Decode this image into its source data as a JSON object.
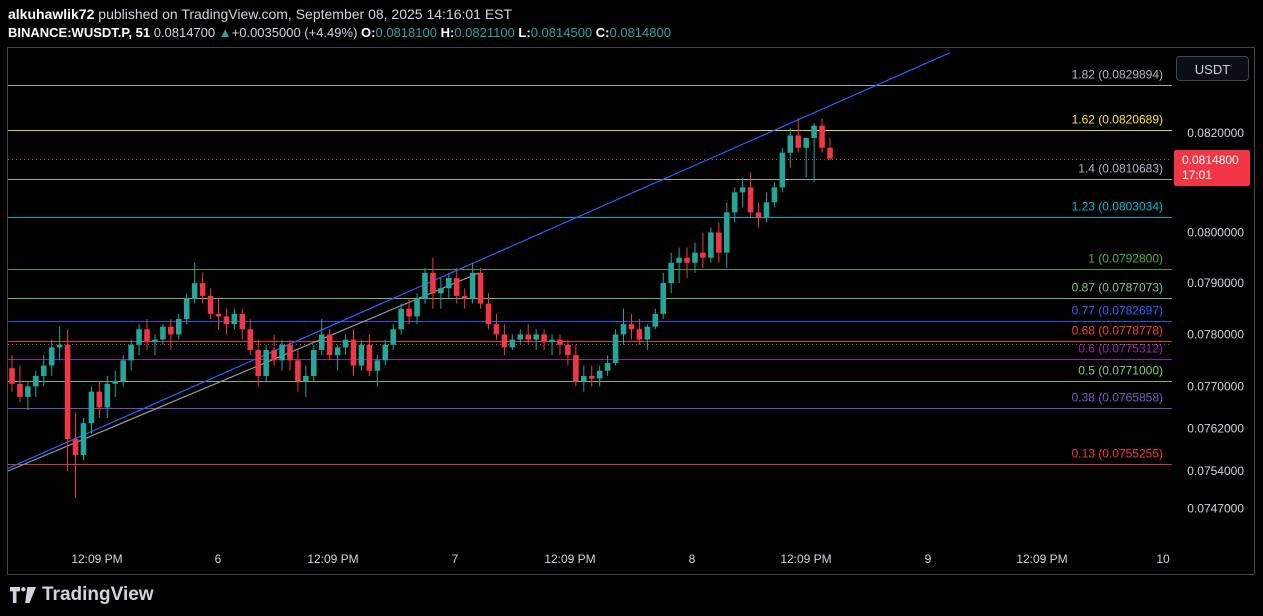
{
  "header": {
    "publisher": "alkuhawlik72",
    "published_text": "published on TradingView.com, September 08, 2025 14:16:01 EST",
    "symbol": "BINANCE:WUSDT.P, 51",
    "last": "0.0814700",
    "change_arrow": "▲",
    "change": "+0.0035000 (+4.49%)",
    "o_label": "O:",
    "o": "0.0818100",
    "h_label": "H:",
    "h": "0.0821100",
    "l_label": "L:",
    "l": "0.0814500",
    "c_label": "C:",
    "c": "0.0814800"
  },
  "currency_button": "USDT",
  "price_tag": {
    "price": "0.0814800",
    "countdown": "17:01"
  },
  "footer": {
    "brand": "TradingView"
  },
  "colors": {
    "up": "#26a69a",
    "down": "#f23645",
    "trendline": "#2962ff",
    "trendline2": "#9598a1"
  },
  "chart_data": {
    "type": "candlestick",
    "y_scale": "log",
    "y_axis_labels": [
      "0.0820000",
      "0.0800000",
      "0.0790000",
      "0.0780000",
      "0.0770000",
      "0.0762000",
      "0.0754000",
      "0.0747000"
    ],
    "y_axis_values": [
      0.082,
      0.08,
      0.079,
      0.078,
      0.077,
      0.0762,
      0.0754,
      0.0747
    ],
    "x_axis_labels": [
      "12:09 PM",
      "6",
      "12:09 PM",
      "7",
      "12:09 PM",
      "8",
      "12:09 PM",
      "9",
      "12:09 PM",
      "10"
    ],
    "fib_levels": [
      {
        "ratio": "1.82",
        "price": 0.0829894,
        "label": "1.82 (0.0829894)",
        "color": "#b2b5be"
      },
      {
        "ratio": "1.62",
        "price": 0.0820689,
        "label": "1.62 (0.0820689)",
        "color": "#f7e733"
      },
      {
        "ratio": "1.4",
        "price": 0.0810683,
        "label": "1.4 (0.0810683)",
        "color": "#b2b5be"
      },
      {
        "ratio": "1.23",
        "price": 0.0803034,
        "label": "1.23 (0.0803034)",
        "color": "#00bcd4"
      },
      {
        "ratio": "1",
        "price": 0.07928,
        "label": "1 (0.0792800)",
        "color": "#4caf50"
      },
      {
        "ratio": "0.87",
        "price": 0.0787073,
        "label": "0.87 (0.0787073)",
        "color": "#81c784"
      },
      {
        "ratio": "0.77",
        "price": 0.0782697,
        "label": "0.77 (0.0782697)",
        "color": "#2962ff"
      },
      {
        "ratio": "0.68",
        "price": 0.0778778,
        "label": "0.68 (0.0778778)",
        "color": "#f44336"
      },
      {
        "ratio": "0.6",
        "price": 0.0775312,
        "label": "0.6 (0.0775312)",
        "color": "#9c27b0"
      },
      {
        "ratio": "0.5",
        "price": 0.0771,
        "label": "0.5 (0.0771000)",
        "color": "#81c784"
      },
      {
        "ratio": "0.38",
        "price": 0.0765858,
        "label": "0.38 (0.0765858)",
        "color": "#7e57c2"
      },
      {
        "ratio": "0.13",
        "price": 0.0755255,
        "label": "0.13 (0.0755255)",
        "color": "#f23645"
      }
    ],
    "trendlines": [
      {
        "from": [
          0,
          0.07545
        ],
        "to": [
          1.0,
          0.08365
        ],
        "color": "#2962ff"
      },
      {
        "from": [
          0,
          0.0754
        ],
        "to": [
          0.5,
          0.0792
        ],
        "color": "#9598a1"
      }
    ],
    "current_price": 0.08148,
    "candles": [
      [
        0.07735,
        0.0776,
        0.0769,
        0.07705
      ],
      [
        0.07705,
        0.0774,
        0.0767,
        0.0768
      ],
      [
        0.0768,
        0.0771,
        0.07655,
        0.077
      ],
      [
        0.077,
        0.0773,
        0.0768,
        0.0772
      ],
      [
        0.0772,
        0.0776,
        0.077,
        0.0774
      ],
      [
        0.0774,
        0.0779,
        0.0772,
        0.07775
      ],
      [
        0.07775,
        0.07815,
        0.0775,
        0.0778
      ],
      [
        0.0778,
        0.0781,
        0.0754,
        0.076
      ],
      [
        0.076,
        0.0765,
        0.0749,
        0.0757
      ],
      [
        0.0757,
        0.0764,
        0.0756,
        0.0763
      ],
      [
        0.0763,
        0.077,
        0.0761,
        0.0769
      ],
      [
        0.0769,
        0.0771,
        0.0764,
        0.0766
      ],
      [
        0.0766,
        0.0772,
        0.0764,
        0.07705
      ],
      [
        0.07705,
        0.0773,
        0.0768,
        0.0771
      ],
      [
        0.0771,
        0.0776,
        0.077,
        0.0775
      ],
      [
        0.0775,
        0.0779,
        0.0773,
        0.0778
      ],
      [
        0.0778,
        0.0782,
        0.0776,
        0.0781
      ],
      [
        0.0781,
        0.0783,
        0.0777,
        0.07785
      ],
      [
        0.07785,
        0.078,
        0.0776,
        0.0779
      ],
      [
        0.0779,
        0.0782,
        0.0778,
        0.07815
      ],
      [
        0.07815,
        0.0783,
        0.0777,
        0.078
      ],
      [
        0.078,
        0.0784,
        0.0779,
        0.0783
      ],
      [
        0.0783,
        0.0788,
        0.0782,
        0.0787
      ],
      [
        0.0787,
        0.0794,
        0.0786,
        0.079
      ],
      [
        0.079,
        0.0792,
        0.0786,
        0.07875
      ],
      [
        0.07875,
        0.0789,
        0.0783,
        0.0784
      ],
      [
        0.0784,
        0.0787,
        0.0781,
        0.07835
      ],
      [
        0.07835,
        0.0785,
        0.078,
        0.0782
      ],
      [
        0.0782,
        0.0785,
        0.0781,
        0.0784
      ],
      [
        0.0784,
        0.0785,
        0.0779,
        0.0781
      ],
      [
        0.0781,
        0.0783,
        0.0776,
        0.0777
      ],
      [
        0.0777,
        0.0779,
        0.077,
        0.0772
      ],
      [
        0.0772,
        0.0778,
        0.0771,
        0.0777
      ],
      [
        0.0777,
        0.078,
        0.0774,
        0.0775
      ],
      [
        0.0775,
        0.0779,
        0.0773,
        0.0778
      ],
      [
        0.0778,
        0.0779,
        0.0773,
        0.0775
      ],
      [
        0.0775,
        0.0777,
        0.0769,
        0.0771
      ],
      [
        0.0771,
        0.0774,
        0.0768,
        0.0772
      ],
      [
        0.0772,
        0.0778,
        0.0771,
        0.0777
      ],
      [
        0.0777,
        0.0783,
        0.0776,
        0.078
      ],
      [
        0.078,
        0.0781,
        0.0775,
        0.0776
      ],
      [
        0.0776,
        0.0778,
        0.0773,
        0.07775
      ],
      [
        0.07775,
        0.078,
        0.0776,
        0.0779
      ],
      [
        0.0779,
        0.0781,
        0.0772,
        0.0774
      ],
      [
        0.0774,
        0.0779,
        0.0773,
        0.0778
      ],
      [
        0.0778,
        0.078,
        0.0772,
        0.0773
      ],
      [
        0.0773,
        0.0776,
        0.077,
        0.0775
      ],
      [
        0.0775,
        0.0779,
        0.0774,
        0.0778
      ],
      [
        0.0778,
        0.0782,
        0.0777,
        0.0781
      ],
      [
        0.0781,
        0.0786,
        0.078,
        0.0785
      ],
      [
        0.0785,
        0.0787,
        0.0782,
        0.07835
      ],
      [
        0.07835,
        0.0788,
        0.0782,
        0.0787
      ],
      [
        0.0787,
        0.0793,
        0.0786,
        0.0792
      ],
      [
        0.0792,
        0.0795,
        0.0785,
        0.0788
      ],
      [
        0.0788,
        0.0791,
        0.0785,
        0.0789
      ],
      [
        0.0789,
        0.0792,
        0.0787,
        0.0791
      ],
      [
        0.0791,
        0.0793,
        0.0786,
        0.07875
      ],
      [
        0.07875,
        0.0789,
        0.0785,
        0.0787
      ],
      [
        0.0787,
        0.0794,
        0.0786,
        0.0792
      ],
      [
        0.0792,
        0.0793,
        0.0785,
        0.0786
      ],
      [
        0.0786,
        0.0788,
        0.0781,
        0.0782
      ],
      [
        0.0782,
        0.0784,
        0.0779,
        0.078
      ],
      [
        0.078,
        0.0782,
        0.0776,
        0.07775
      ],
      [
        0.07775,
        0.078,
        0.0777,
        0.0779
      ],
      [
        0.0779,
        0.0781,
        0.0778,
        0.078
      ],
      [
        0.078,
        0.0782,
        0.0778,
        0.0779
      ],
      [
        0.0779,
        0.0781,
        0.0777,
        0.078
      ],
      [
        0.078,
        0.0781,
        0.0777,
        0.07785
      ],
      [
        0.07785,
        0.078,
        0.0776,
        0.0779
      ],
      [
        0.0779,
        0.078,
        0.0776,
        0.0778
      ],
      [
        0.0778,
        0.0779,
        0.0774,
        0.0776
      ],
      [
        0.0776,
        0.0778,
        0.077,
        0.0771
      ],
      [
        0.0771,
        0.0774,
        0.0769,
        0.0772
      ],
      [
        0.0772,
        0.0774,
        0.077,
        0.07715
      ],
      [
        0.07715,
        0.0774,
        0.077,
        0.0773
      ],
      [
        0.0773,
        0.0776,
        0.0772,
        0.07745
      ],
      [
        0.07745,
        0.0781,
        0.0774,
        0.078
      ],
      [
        0.078,
        0.0785,
        0.0778,
        0.0782
      ],
      [
        0.0782,
        0.0784,
        0.0779,
        0.0781
      ],
      [
        0.0781,
        0.0783,
        0.0778,
        0.0779
      ],
      [
        0.0779,
        0.0782,
        0.0777,
        0.07815
      ],
      [
        0.07815,
        0.0785,
        0.0781,
        0.0784
      ],
      [
        0.0784,
        0.0792,
        0.0783,
        0.079
      ],
      [
        0.079,
        0.0796,
        0.0788,
        0.0794
      ],
      [
        0.0794,
        0.0797,
        0.079,
        0.0795
      ],
      [
        0.0795,
        0.0797,
        0.0791,
        0.0794
      ],
      [
        0.0794,
        0.0798,
        0.0792,
        0.0796
      ],
      [
        0.0796,
        0.08,
        0.0793,
        0.0795
      ],
      [
        0.0795,
        0.0801,
        0.0794,
        0.08
      ],
      [
        0.08,
        0.0802,
        0.0794,
        0.0796
      ],
      [
        0.0796,
        0.0806,
        0.0793,
        0.0804
      ],
      [
        0.0804,
        0.0809,
        0.0802,
        0.0808
      ],
      [
        0.0808,
        0.0811,
        0.0805,
        0.0809
      ],
      [
        0.0809,
        0.0812,
        0.0803,
        0.0804
      ],
      [
        0.0804,
        0.0806,
        0.0801,
        0.0803
      ],
      [
        0.0803,
        0.0808,
        0.0802,
        0.0806
      ],
      [
        0.0806,
        0.081,
        0.0805,
        0.0809
      ],
      [
        0.0809,
        0.0817,
        0.0808,
        0.0816
      ],
      [
        0.0816,
        0.0821,
        0.0813,
        0.08195
      ],
      [
        0.08195,
        0.0823,
        0.0816,
        0.0817
      ],
      [
        0.0817,
        0.0819,
        0.0811,
        0.0819
      ],
      [
        0.0819,
        0.0822,
        0.081,
        0.08215
      ],
      [
        0.08215,
        0.0823,
        0.0816,
        0.0817
      ],
      [
        0.0817,
        0.0819,
        0.08145,
        0.08148
      ]
    ]
  }
}
